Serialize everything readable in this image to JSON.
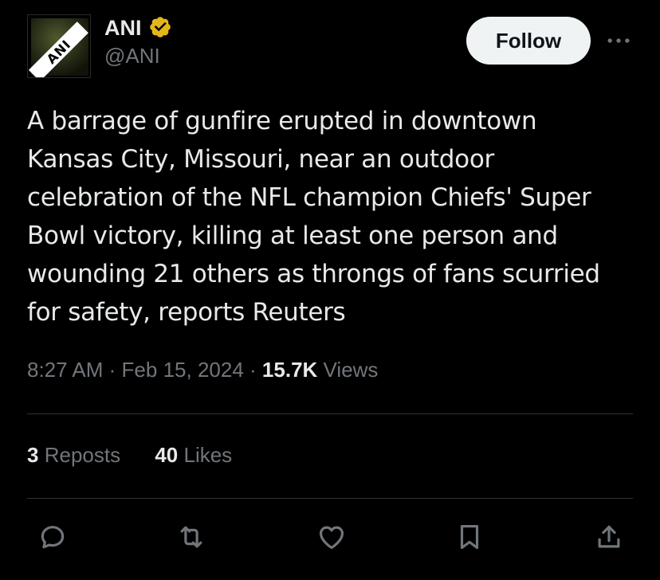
{
  "author": {
    "display_name": "ANI",
    "handle": "@ANI",
    "avatar_text": "ANI",
    "verified_badge_color": "#e2b719"
  },
  "header": {
    "follow_label": "Follow",
    "more_icon": "more-horizontal-icon"
  },
  "tweet": {
    "text": "A barrage of gunfire erupted in downtown\nKansas City, Missouri, near an outdoor\ncelebration of the NFL champion Chiefs' Super\nBowl victory, killing at least one person and\nwounding 21 others as throngs of fans scurried\nfor safety, reports Reuters",
    "time": "8:27 AM",
    "separator": "·",
    "date": "Feb 15, 2024",
    "views_count": "15.7K",
    "views_label": "Views"
  },
  "stats": {
    "reposts_count": "3",
    "reposts_label": "Reposts",
    "likes_count": "40",
    "likes_label": "Likes"
  },
  "actions": {
    "reply_icon": "reply-icon",
    "repost_icon": "repost-icon",
    "like_icon": "heart-icon",
    "bookmark_icon": "bookmark-icon",
    "share_icon": "share-icon"
  },
  "colors": {
    "background": "#000000",
    "primary_text": "#e7e9ea",
    "secondary_text": "#71767b",
    "divider": "#2f3336",
    "follow_button_bg": "#eff3f4"
  }
}
